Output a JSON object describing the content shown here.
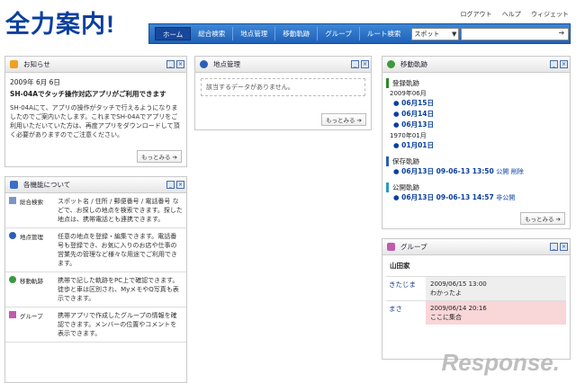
{
  "app": {
    "logo": "全力案内!"
  },
  "toplinks": [
    "ログアウト",
    "ヘルプ",
    "ウィジェット"
  ],
  "nav": {
    "items": [
      "ホーム",
      "総合検索",
      "地点管理",
      "移動軌跡",
      "グループ",
      "ルート検索"
    ],
    "search_select": "スポット",
    "search_value": ""
  },
  "news": {
    "title": "お知らせ",
    "date": "2009年 6月 6日",
    "headline": "SH-04Aでタッチ操作対応アプリがご利用できます",
    "body": "SH-04Aにて、アプリの操作がタッチで行えるようになりましたのでご案内いたします。これまでSH-04Aでアプリをご利用いただいていた方は、再度アプリをダウンロードして頂く必要がありますのでご注意ください。",
    "more": "もっとみる"
  },
  "features": {
    "title": "各機能について",
    "rows": [
      {
        "label": "総合検索",
        "desc": "スポット名 / 住所 / 郵便番号 / 電話番号 などで、お探しの地点を検索できます。探した地点は、携帯電話とも連携できます。"
      },
      {
        "label": "地点管理",
        "desc": "任意の地点を登録・編集できます。電話番号も登録でき、お気に入りのお店や仕事の営業先の管理など様々な用途でご利用できます。"
      },
      {
        "label": "移動軌跡",
        "desc": "携帯で記した軌跡をPC上で確認できます。徒歩と車は区別され、MyメモやQ写真も表示できます。"
      },
      {
        "label": "グループ",
        "desc": "携帯アプリで作成したグループの情報を確認できます。メンバーの位置やコメントを表示できます。"
      }
    ]
  },
  "spots": {
    "title": "地点管理",
    "empty": "該当するデータがありません。",
    "more": "もっとみる"
  },
  "tracks": {
    "title": "移動軌跡",
    "registered": {
      "label": "登録軌跡",
      "groups": [
        {
          "month": "2009年06月",
          "days": [
            "06月15日",
            "06月14日",
            "06月13日"
          ]
        },
        {
          "month": "1970年01月",
          "days": [
            "01月01日"
          ]
        }
      ]
    },
    "saved": {
      "label": "保存軌跡",
      "entry": "06月13日 09-06-13 13:50",
      "tag1": "公開",
      "tag2": "削除"
    },
    "public": {
      "label": "公開軌跡",
      "entry": "06月13日 09-06-13 14:57",
      "tag1": "非公開"
    },
    "more": "もっとみる"
  },
  "group": {
    "title": "グループ",
    "name": "山田家",
    "messages": [
      {
        "who": "きたじま",
        "time": "2009/06/15 13:00",
        "text": "わかったよ",
        "style": "grey"
      },
      {
        "who": "まさ",
        "time": "2009/06/14 20:16",
        "text": "ここに集合",
        "style": "pink"
      }
    ]
  },
  "watermark": "Response."
}
